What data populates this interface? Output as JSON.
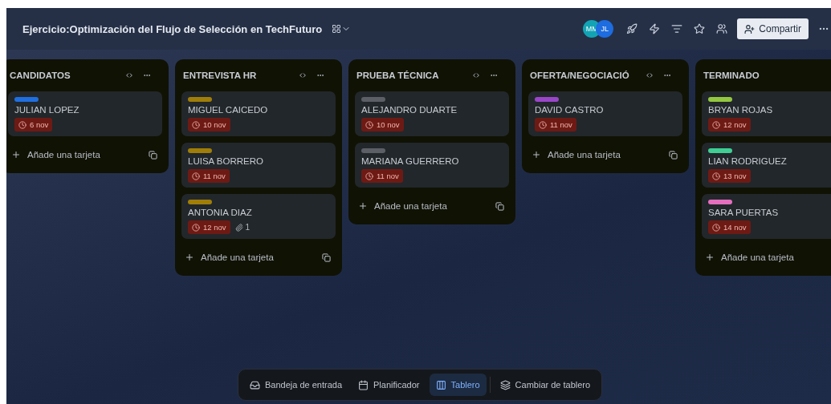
{
  "header": {
    "title": "Ejercicio:Optimización del Flujo de Selección en TechFuturo",
    "avatars": [
      {
        "initials": "MM",
        "color": "#12a4b5"
      },
      {
        "initials": "JL",
        "color": "#1d6ce0"
      }
    ],
    "share_label": "Compartir"
  },
  "columns": [
    {
      "title": "CANDIDATOS",
      "add_label": "Añade una tarjeta",
      "cards": [
        {
          "name": "JULIAN LOPEZ",
          "color": "#1f6fe0",
          "due": "6 nov"
        }
      ]
    },
    {
      "title": "ENTREVISTA HR",
      "add_label": "Añade una tarjeta",
      "cards": [
        {
          "name": "MIGUEL CAICEDO",
          "color": "#a07e08",
          "due": "10 nov"
        },
        {
          "name": "LUISA BORRERO",
          "color": "#a07e08",
          "due": "11 nov"
        },
        {
          "name": "ANTONIA DIAZ",
          "color": "#a07e08",
          "due": "12 nov",
          "attachments": "1"
        }
      ]
    },
    {
      "title": "PRUEBA TÉCNICA",
      "add_label": "Añade una tarjeta",
      "cards": [
        {
          "name": "ALEJANDRO DUARTE",
          "color": "#5c5f66",
          "due": "10 nov"
        },
        {
          "name": "MARIANA GUERRERO",
          "color": "#5c5f66",
          "due": "11 nov"
        }
      ]
    },
    {
      "title": "OFERTA/NEGOCIACIÓ",
      "add_label": "Añade una tarjeta",
      "cards": [
        {
          "name": "DAVID CASTRO",
          "color": "#9a46c8",
          "due": "11 nov"
        }
      ]
    },
    {
      "title": "TERMINADO",
      "add_label": "Añade una tarjeta",
      "cards": [
        {
          "name": "BRYAN ROJAS",
          "color": "#94c740",
          "due": "12 nov"
        },
        {
          "name": "LIAN RODRIGUEZ",
          "color": "#3fcf94",
          "due": "13 nov"
        },
        {
          "name": "SARA PUERTAS",
          "color": "#e56fbf",
          "due": "14 nov"
        }
      ]
    }
  ],
  "bottom_nav": [
    {
      "label": "Bandeja de entrada",
      "kind": "inbox",
      "selected": false
    },
    {
      "label": "Planificador",
      "kind": "planner",
      "selected": false
    },
    {
      "label": "Tablero",
      "kind": "board",
      "selected": true
    },
    {
      "label": "Cambiar de tablero",
      "kind": "switch",
      "selected": false
    }
  ]
}
